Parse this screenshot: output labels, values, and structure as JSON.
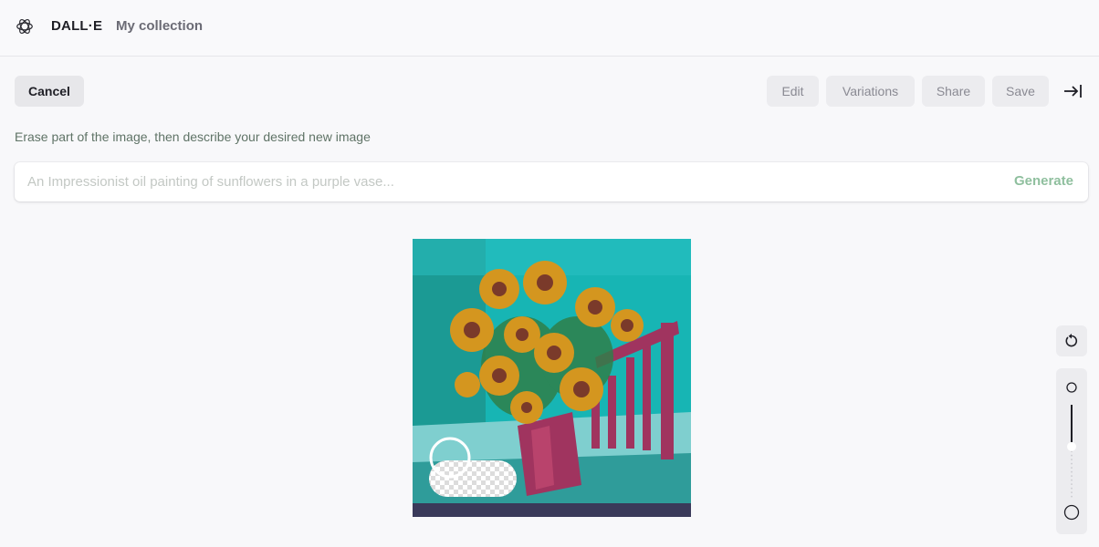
{
  "header": {
    "brand": "DALL·E",
    "collection_link": "My collection",
    "logo_icon": "openai-logo-icon"
  },
  "toolbar": {
    "cancel_label": "Cancel",
    "edit_label": "Edit",
    "variations_label": "Variations",
    "share_label": "Share",
    "save_label": "Save",
    "collapse_icon": "collapse-right-icon"
  },
  "editor": {
    "instruction": "Erase part of the image, then describe your desired new image",
    "prompt_value": "",
    "prompt_placeholder": "An Impressionist oil painting of sunflowers in a purple vase...",
    "generate_label": "Generate"
  },
  "image": {
    "subject": "painting of sunflowers in a vase",
    "erased_region": "bottom-left",
    "colors": {
      "background": "#17b5b4",
      "petals": "#d4961f",
      "vase": "#a0345f",
      "table": "#7fcfcf"
    }
  },
  "tools": {
    "undo_icon": "undo-icon",
    "brush_size_fraction": 0.45
  }
}
